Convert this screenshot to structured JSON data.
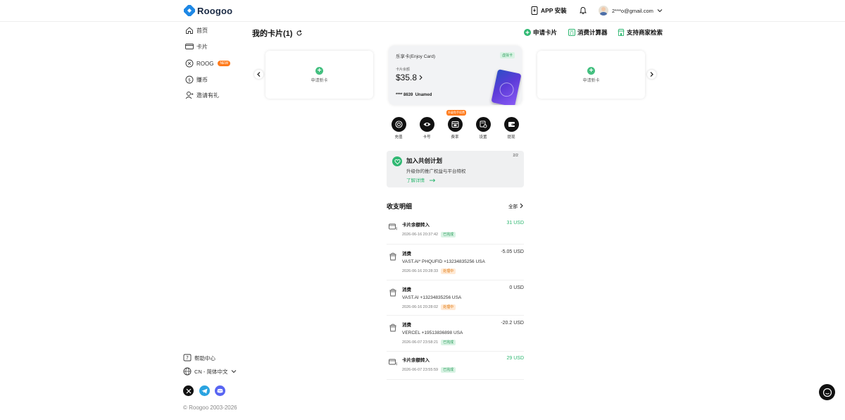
{
  "header": {
    "logo_text": "Roogoo",
    "app_install": "APP 安装",
    "user_email": "2***o@gmail.com"
  },
  "sidebar": {
    "items": [
      {
        "label": "首页",
        "icon": "home-icon"
      },
      {
        "label": "卡片",
        "icon": "card-icon"
      },
      {
        "label": "ROOG",
        "icon": "roog-coin-icon",
        "badge": "NEW"
      },
      {
        "label": "賺币",
        "icon": "earn-coin-icon"
      },
      {
        "label": "邀请有礼",
        "icon": "invite-user-icon"
      }
    ],
    "help": "帮助中心",
    "language": "CN - 简体中文",
    "copyright": "© Roogoo 2003-2026"
  },
  "page": {
    "title": "我的卡片(1)",
    "actions": [
      {
        "label": "申请卡片",
        "icon": "add-circle-icon"
      },
      {
        "label": "消费计算器",
        "icon": "calculator-icon"
      },
      {
        "label": "支持商家检索",
        "icon": "store-search-icon"
      }
    ]
  },
  "cards": {
    "apply_label": "申请新卡",
    "main": {
      "name": "乐享卡(Enjoy Card)",
      "tag": "虚拟卡",
      "balance_label": "卡片余额",
      "balance": "$35.8",
      "number": "**** 8639",
      "holder": "Unamed"
    }
  },
  "quick_actions": {
    "badge": "升级免手续费",
    "items": [
      {
        "label": "充值",
        "icon": "recharge-icon"
      },
      {
        "label": "卡号",
        "icon": "eye-icon"
      },
      {
        "label": "费率",
        "icon": "fee-icon"
      },
      {
        "label": "设置",
        "icon": "settings-icon"
      },
      {
        "label": "提现",
        "icon": "withdraw-icon"
      }
    ]
  },
  "promo": {
    "title": "加入共创计划",
    "page": "2/2",
    "subtitle": "升级你的推广权益与平台特权",
    "link": "了解详情"
  },
  "transactions": {
    "heading": "收支明细",
    "all": "全部",
    "items": [
      {
        "title": "卡片余额转入",
        "desc": "",
        "time": "2026-06-16 20:37:42",
        "status": "已完成",
        "amount": "31 USD",
        "type": "in"
      },
      {
        "title": "消费",
        "desc": "VAST.AI* PHQUFID +13234835256 USA",
        "time": "2026-06-16 20:28:33",
        "status": "处理中",
        "amount": "-5.05 USD",
        "type": "out"
      },
      {
        "title": "消费",
        "desc": "VAST.AI +13234835256 USA",
        "time": "2026-06-16 20:28:02",
        "status": "处理中",
        "amount": "0 USD",
        "type": "out"
      },
      {
        "title": "消费",
        "desc": "VERCEL +19513836898 USA",
        "time": "2026-06-07 23:58:21",
        "status": "已完成",
        "amount": "-20.2 USD",
        "type": "out"
      },
      {
        "title": "卡片余额转入",
        "desc": "",
        "time": "2026-06-07 23:55:59",
        "status": "已完成",
        "amount": "29 USD",
        "type": "in"
      }
    ]
  },
  "colors": {
    "accent_green": "#2fb872",
    "badge_orange": "#ff7a1a",
    "income_green": "#2fb872"
  }
}
